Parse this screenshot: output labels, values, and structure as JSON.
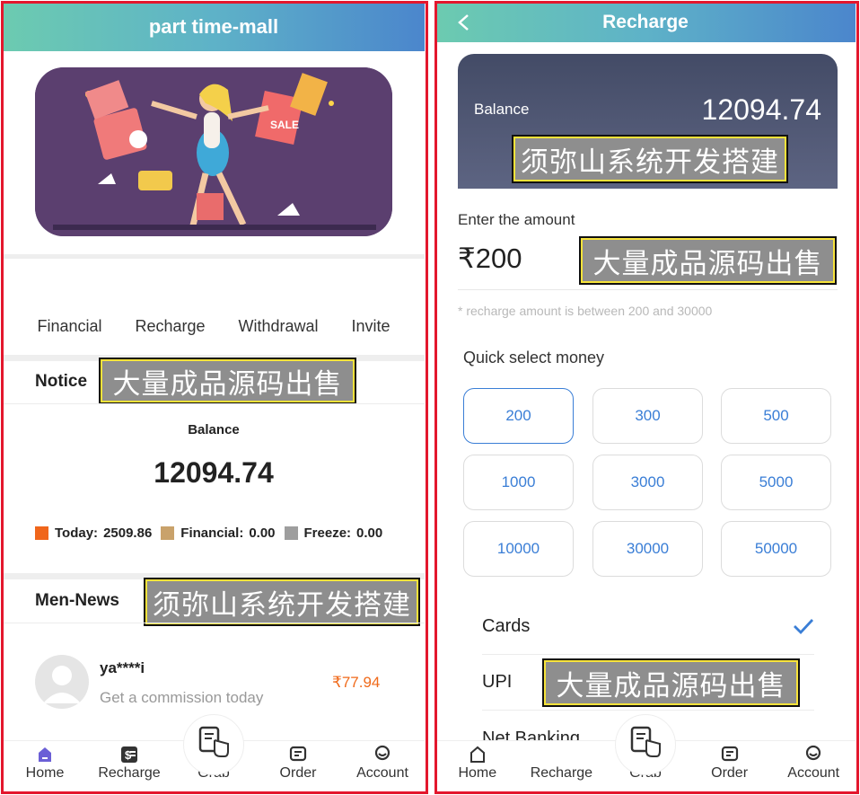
{
  "left": {
    "title": "part time-mall",
    "quicknav": [
      "Financial",
      "Recharge",
      "Withdrawal",
      "Invite"
    ],
    "notice_title": "Notice",
    "watermark_notice": "大量成品源码出售",
    "balance_label": "Balance",
    "balance_value": "12094.74",
    "stats": [
      {
        "label": "Today:",
        "value": "2509.86",
        "color": "#f0661b"
      },
      {
        "label": "Financial:",
        "value": "0.00",
        "color": "#c9a26b"
      },
      {
        "label": "Freeze:",
        "value": "0.00",
        "color": "#9e9e9e"
      }
    ],
    "news_title": "Men-News",
    "watermark_news": "须弥山系统开发搭建",
    "news": {
      "name": "ya****i",
      "desc": "Get a commission today",
      "amount": "₹77.94"
    },
    "tabs": [
      "Home",
      "Recharge",
      "Grab",
      "Order",
      "Account"
    ]
  },
  "right": {
    "title": "Recharge",
    "balance_label": "Balance",
    "balance_value": "12094.74",
    "watermark_card": "须弥山系统开发搭建",
    "enter_label": "Enter the amount",
    "amount_value": "₹200",
    "watermark_amount": "大量成品源码出售",
    "hint": "* recharge amount is between 200 and 30000",
    "quick_label": "Quick select money",
    "options": [
      "200",
      "300",
      "500",
      "1000",
      "3000",
      "5000",
      "10000",
      "30000",
      "50000"
    ],
    "selected_option": "200",
    "payment_methods": [
      "Cards",
      "UPI",
      "Net Banking"
    ],
    "watermark_upi": "大量成品源码出售",
    "tabs": [
      "Home",
      "Recharge",
      "Grab",
      "Order",
      "Account"
    ]
  },
  "colors": {
    "accent": "#3a7ed6",
    "brand_start": "#6ccbb0",
    "brand_end": "#4b86cc",
    "frame": "#e3172d",
    "home_active": "#6b5fd6"
  }
}
